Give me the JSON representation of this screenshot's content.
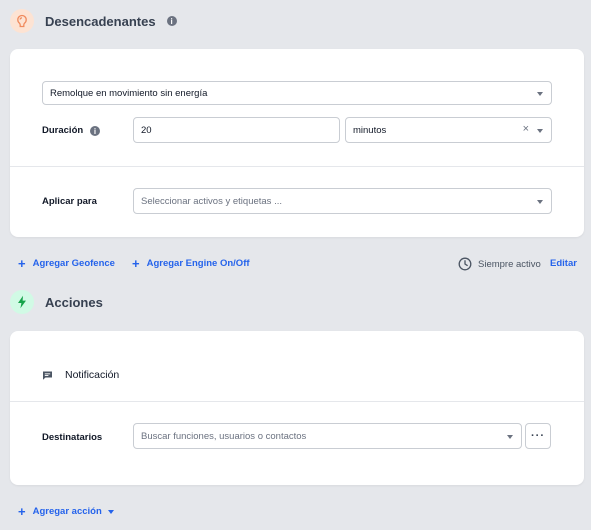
{
  "triggers": {
    "title": "Desencadenantes",
    "info_glyph": "i",
    "trigger_select": {
      "value": "Remolque en movimiento sin energía"
    },
    "duration": {
      "label": "Duración",
      "value": "20",
      "unit_value": "minutos",
      "clear_glyph": "×"
    },
    "apply_to": {
      "label": "Aplicar para",
      "placeholder": "Seleccionar activos y etiquetas ..."
    },
    "add_geofence_label": "Agregar Geofence",
    "add_engine_label": "Agregar Engine On/Off",
    "schedule_status": "Siempre activo",
    "edit_label": "Editar"
  },
  "actions": {
    "title": "Acciones",
    "notification_label": "Notificación",
    "recipients": {
      "label": "Destinatarios",
      "placeholder": "Buscar funciones, usuarios o contactos",
      "more_glyph": "···"
    },
    "add_action_label": "Agregar acción"
  },
  "plus_glyph": "+",
  "icons": {
    "trigger": "hand-icon",
    "info": "info-icon",
    "actions": "lightning-icon",
    "notification": "chat-bubble-icon",
    "clock": "clock-icon",
    "caret": "chevron-down-icon"
  },
  "colors": {
    "accent": "#2563eb",
    "trigger_icon_bg": "#fde3d3",
    "trigger_icon": "#f08a5d",
    "actions_icon_bg": "#d1fae5",
    "actions_icon": "#16a34a",
    "page_bg": "#e5e7eb"
  }
}
